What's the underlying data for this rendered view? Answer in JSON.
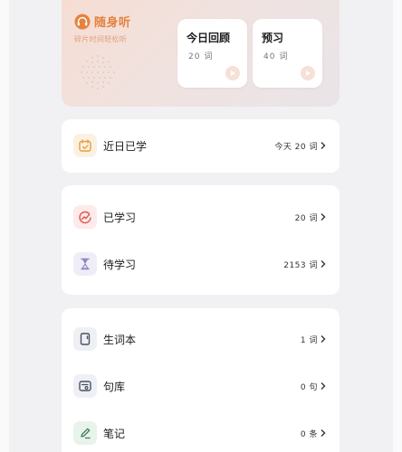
{
  "brand": {
    "title": "随身听",
    "subtitle": "碎片时间轻松听"
  },
  "review_card": {
    "title": "今日回顾",
    "count": "20 词"
  },
  "preview_card": {
    "title": "预习",
    "count": "40 词"
  },
  "recent": {
    "label": "近日已学",
    "value": "今天 20 词"
  },
  "learned": {
    "label": "已学习",
    "value": "20 词"
  },
  "pending": {
    "label": "待学习",
    "value": "2153 词"
  },
  "vocab_book": {
    "label": "生词本",
    "value": "1 词"
  },
  "sentence_bank": {
    "label": "句库",
    "value": "0 句"
  },
  "notes": {
    "label": "笔记",
    "value": "0 条"
  },
  "colors": {
    "accent": "#e5823e",
    "play_bg": "#f7e0d6",
    "card_bg": "#ffffff",
    "page_bg": "#f1f1f3"
  }
}
